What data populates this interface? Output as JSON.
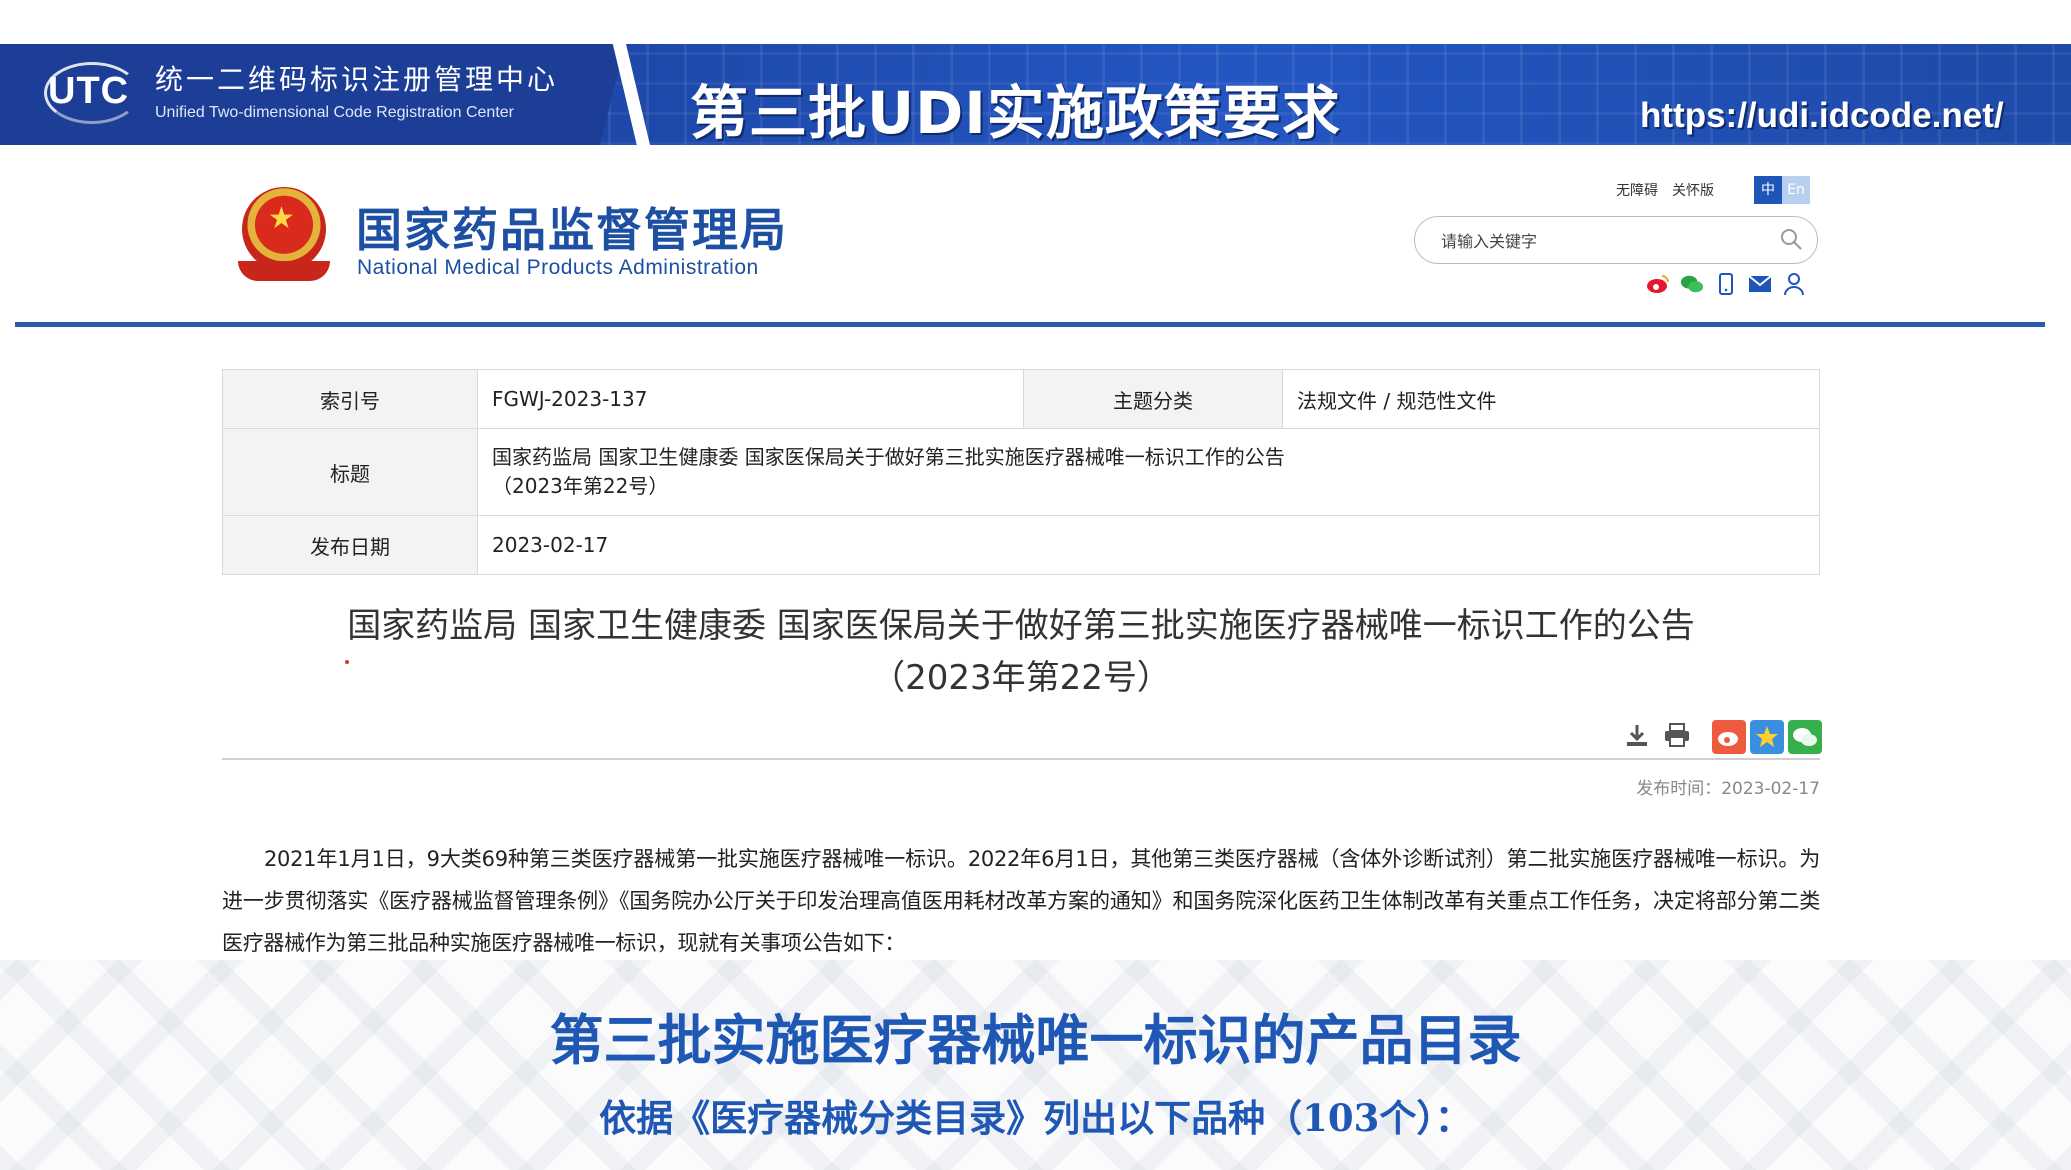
{
  "banner": {
    "org_name_cn": "统一二维码标识注册管理中心",
    "org_name_en": "Unified Two-dimensional Code Registration Center",
    "logo_text": "UTC",
    "title": "第三批UDI实施政策要求",
    "url": "https://udi.idcode.net/"
  },
  "site": {
    "name_cn": "国家药品监督管理局",
    "name_en": "National Medical Products Administration",
    "links": [
      "无障碍",
      "关怀版"
    ],
    "lang": {
      "zh": "中",
      "en": "En"
    },
    "search": {
      "placeholder": "请输入关键字",
      "value": ""
    },
    "social_icons": [
      "weibo-icon",
      "wechat-icon",
      "mobile-icon",
      "mail-icon",
      "user-icon"
    ],
    "brand_color": "#1d4fa3"
  },
  "info_table": {
    "index_label": "索引号",
    "index_value": "FGWJ-2023-137",
    "topic_label": "主题分类",
    "topic_value": "法规文件 / 规范性文件",
    "title_label": "标题",
    "title_value_line1": "国家药监局 国家卫生健康委 国家医保局关于做好第三批实施医疗器械唯一标识工作的公告",
    "title_value_line2": "（2023年第22号）",
    "date_label": "发布日期",
    "date_value": "2023-02-17"
  },
  "article": {
    "title_line1": "国家药监局 国家卫生健康委 国家医保局关于做好第三批实施医疗器械唯一标识工作的公告",
    "title_line2": "（2023年第22号）",
    "tools": [
      "download-icon",
      "print-icon"
    ],
    "share": [
      "weibo-share-icon",
      "qzone-share-icon",
      "wechat-share-icon"
    ],
    "publish_time": "发布时间：2023-02-17",
    "body": "2021年1月1日，9大类69种第三类医疗器械第一批实施医疗器械唯一标识。2022年6月1日，其他第三类医疗器械（含体外诊断试剂）第二批实施医疗器械唯一标识。为进一步贯彻落实《医疗器械监督管理条例》《国务院办公厅关于印发治理高值医用耗材改革方案的通知》和国务院深化医药卫生体制改革有关重点工作任务，决定将部分第二类医疗器械作为第三批品种实施医疗器械唯一标识，现就有关事项公告如下："
  },
  "overlay": {
    "heading": "第三批实施医疗器械唯一标识的产品目录",
    "subheading": "依据《医疗器械分类目录》列出以下品种（103个）：",
    "accent_color": "#1f57b5"
  }
}
